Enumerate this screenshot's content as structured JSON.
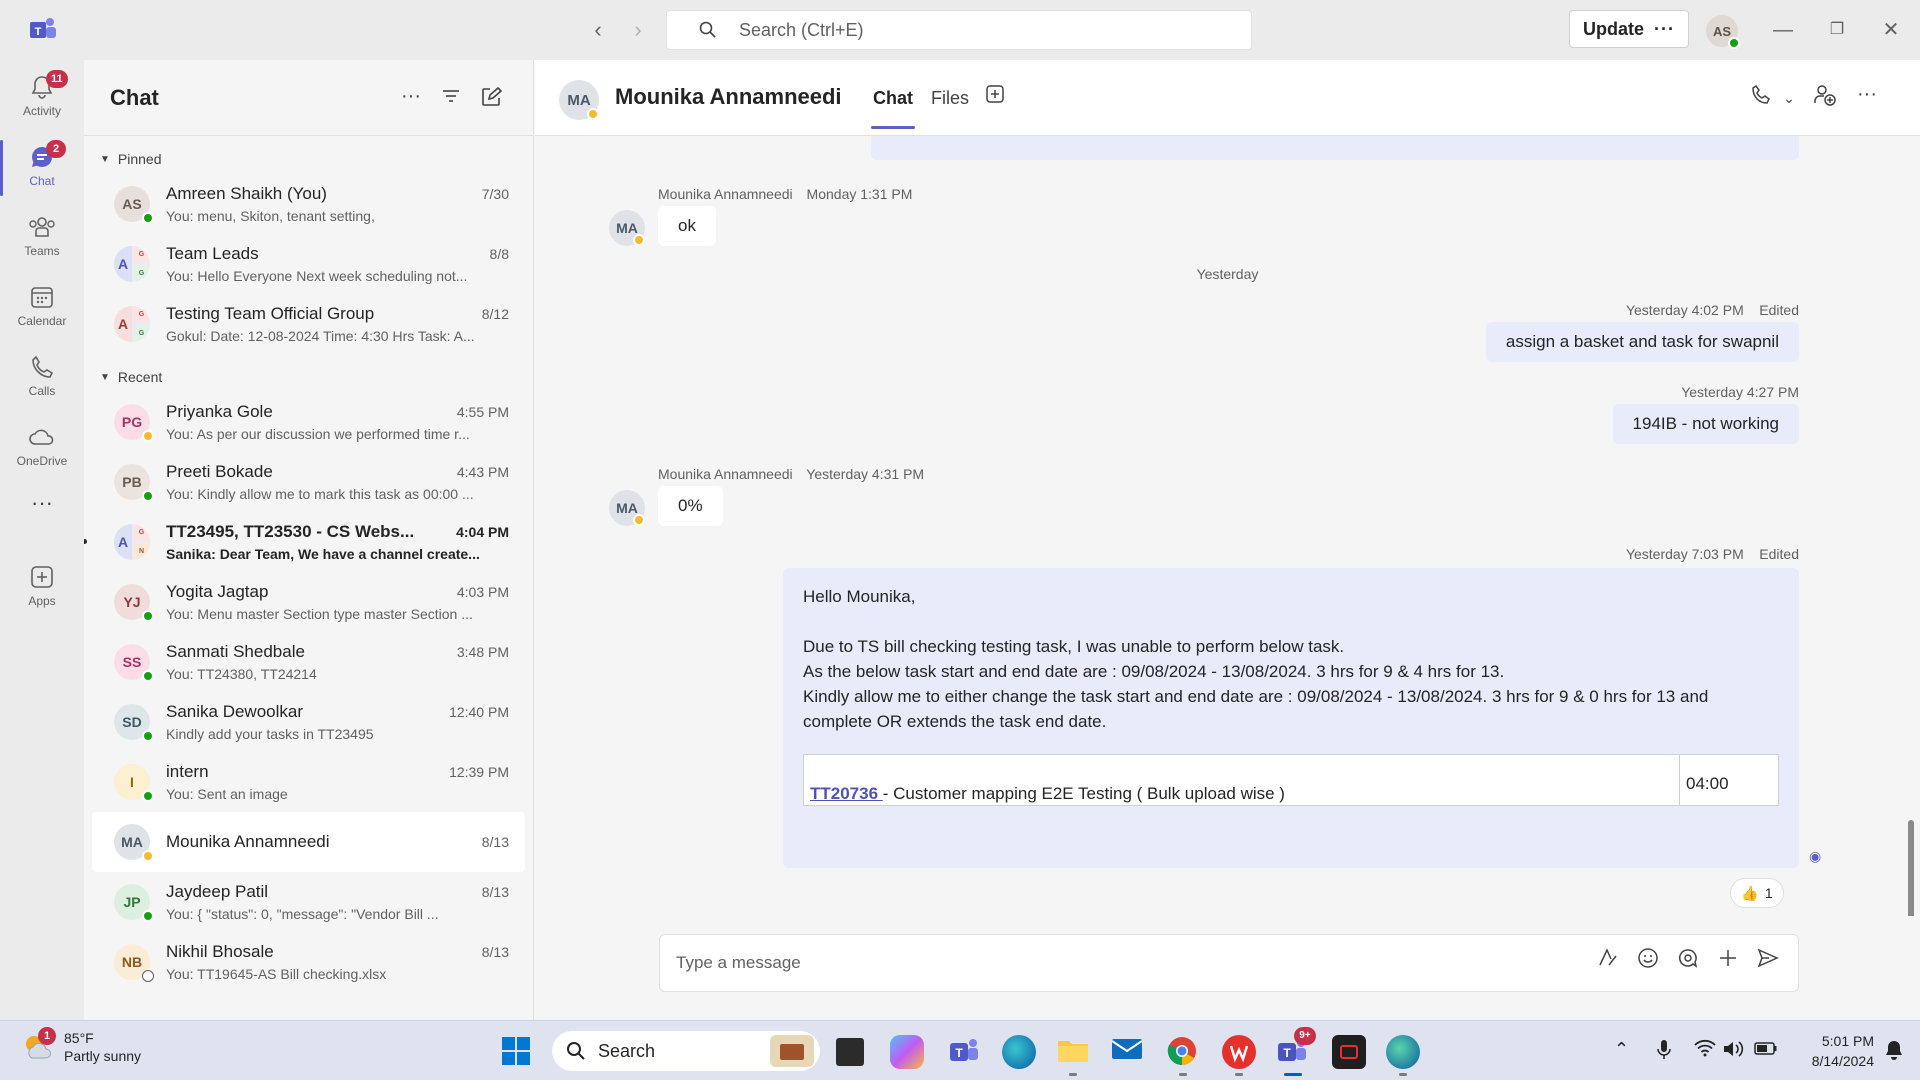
{
  "titlebar": {
    "search_placeholder": "Search (Ctrl+E)",
    "update_label": "Update",
    "user_initials": "AS"
  },
  "rail": [
    {
      "label": "Activity",
      "badge": "11"
    },
    {
      "label": "Chat",
      "badge": "2"
    },
    {
      "label": "Teams",
      "badge": ""
    },
    {
      "label": "Calendar",
      "badge": ""
    },
    {
      "label": "Calls",
      "badge": ""
    },
    {
      "label": "OneDrive",
      "badge": ""
    },
    {
      "label": "Apps",
      "badge": ""
    }
  ],
  "chatlist": {
    "title": "Chat",
    "pinned_label": "Pinned",
    "recent_label": "Recent",
    "pinned": [
      {
        "initials": "AS",
        "name": "Amreen Shaikh (You)",
        "time": "7/30",
        "preview": "You: menu, Skiton, tenant setting,"
      },
      {
        "initials": "A",
        "name": "Team Leads",
        "time": "8/8",
        "preview": "You: Hello Everyone   Next week scheduling not..."
      },
      {
        "initials": "A",
        "name": "Testing Team Official Group",
        "time": "8/12",
        "preview": "Gokul: Date: 12-08-2024 Time: 4:30 Hrs Task: A..."
      }
    ],
    "recent": [
      {
        "initials": "PG",
        "name": "Priyanka Gole",
        "time": "4:55 PM",
        "preview": "You: As per our discussion we performed time r..."
      },
      {
        "initials": "PB",
        "name": "Preeti Bokade",
        "time": "4:43 PM",
        "preview": "You: Kindly allow me to mark this task as 00:00 ..."
      },
      {
        "initials": "A",
        "name": "TT23495, TT23530 - CS Webs...",
        "time": "4:04 PM",
        "preview": "Sanika: Dear Team,   We have a channel create..."
      },
      {
        "initials": "YJ",
        "name": "Yogita Jagtap",
        "time": "4:03 PM",
        "preview": "You: Menu master Section type master Section ..."
      },
      {
        "initials": "SS",
        "name": "Sanmati Shedbale",
        "time": "3:48 PM",
        "preview": "You: TT24380, TT24214"
      },
      {
        "initials": "SD",
        "name": "Sanika Dewoolkar",
        "time": "12:40 PM",
        "preview": "Kindly add your tasks in TT23495"
      },
      {
        "initials": "I",
        "name": "intern",
        "time": "12:39 PM",
        "preview": "You: Sent an image"
      },
      {
        "initials": "MA",
        "name": "Mounika Annamneedi",
        "time": "8/13",
        "preview": ""
      },
      {
        "initials": "JP",
        "name": "Jaydeep Patil",
        "time": "8/13",
        "preview": "You: {     \"status\": 0,     \"message\": \"Vendor Bill ..."
      },
      {
        "initials": "NB",
        "name": "Nikhil Bhosale",
        "time": "8/13",
        "preview": "You: TT19645-AS Bill checking.xlsx"
      }
    ]
  },
  "conversation": {
    "initials": "MA",
    "name": "Mounika Annamneedi",
    "tabs": [
      "Chat",
      "Files"
    ],
    "messages": {
      "m1_sender": "Mounika Annamneedi",
      "m1_time": "Monday 1:31 PM",
      "m1_text": "ok",
      "date_sep": "Yesterday",
      "m2_time": "Yesterday 4:02 PM",
      "m2_edited": "Edited",
      "m2_text": "assign a basket and task for swapnil",
      "m3_time": "Yesterday 4:27 PM",
      "m3_text": "194IB - not working",
      "m4_sender": "Mounika Annamneedi",
      "m4_time": "Yesterday 4:31 PM",
      "m4_text": "0%",
      "m5_time": "Yesterday 7:03 PM",
      "m5_edited": "Edited",
      "m5_line1": "Hello Mounika,",
      "m5_line2": "Due to TS bill checking testing task, I was unable to perform below task.",
      "m5_line3": "As the below task start and end date are : 09/08/2024 - 13/08/2024. 3 hrs for 9 & 4 hrs for 13.",
      "m5_line4": "Kindly allow me to either change the task start and end date are : 09/08/2024 - 13/08/2024. 3 hrs for 9 & 0 hrs for 13 and complete OR extends the task end date.",
      "m5_task_id": "TT20736 ",
      "m5_task_desc": " - Customer mapping E2E Testing ( Bulk upload wise )",
      "m5_task_hours": "04:00",
      "reaction_count": "1"
    },
    "composer_placeholder": "Type a message"
  },
  "taskbar": {
    "weather_temp": "85°F",
    "weather_desc": "Partly sunny",
    "weather_badge": "1",
    "search_label": "Search",
    "teams_badge": "9+",
    "time": "5:01 PM",
    "date": "8/14/2024"
  }
}
